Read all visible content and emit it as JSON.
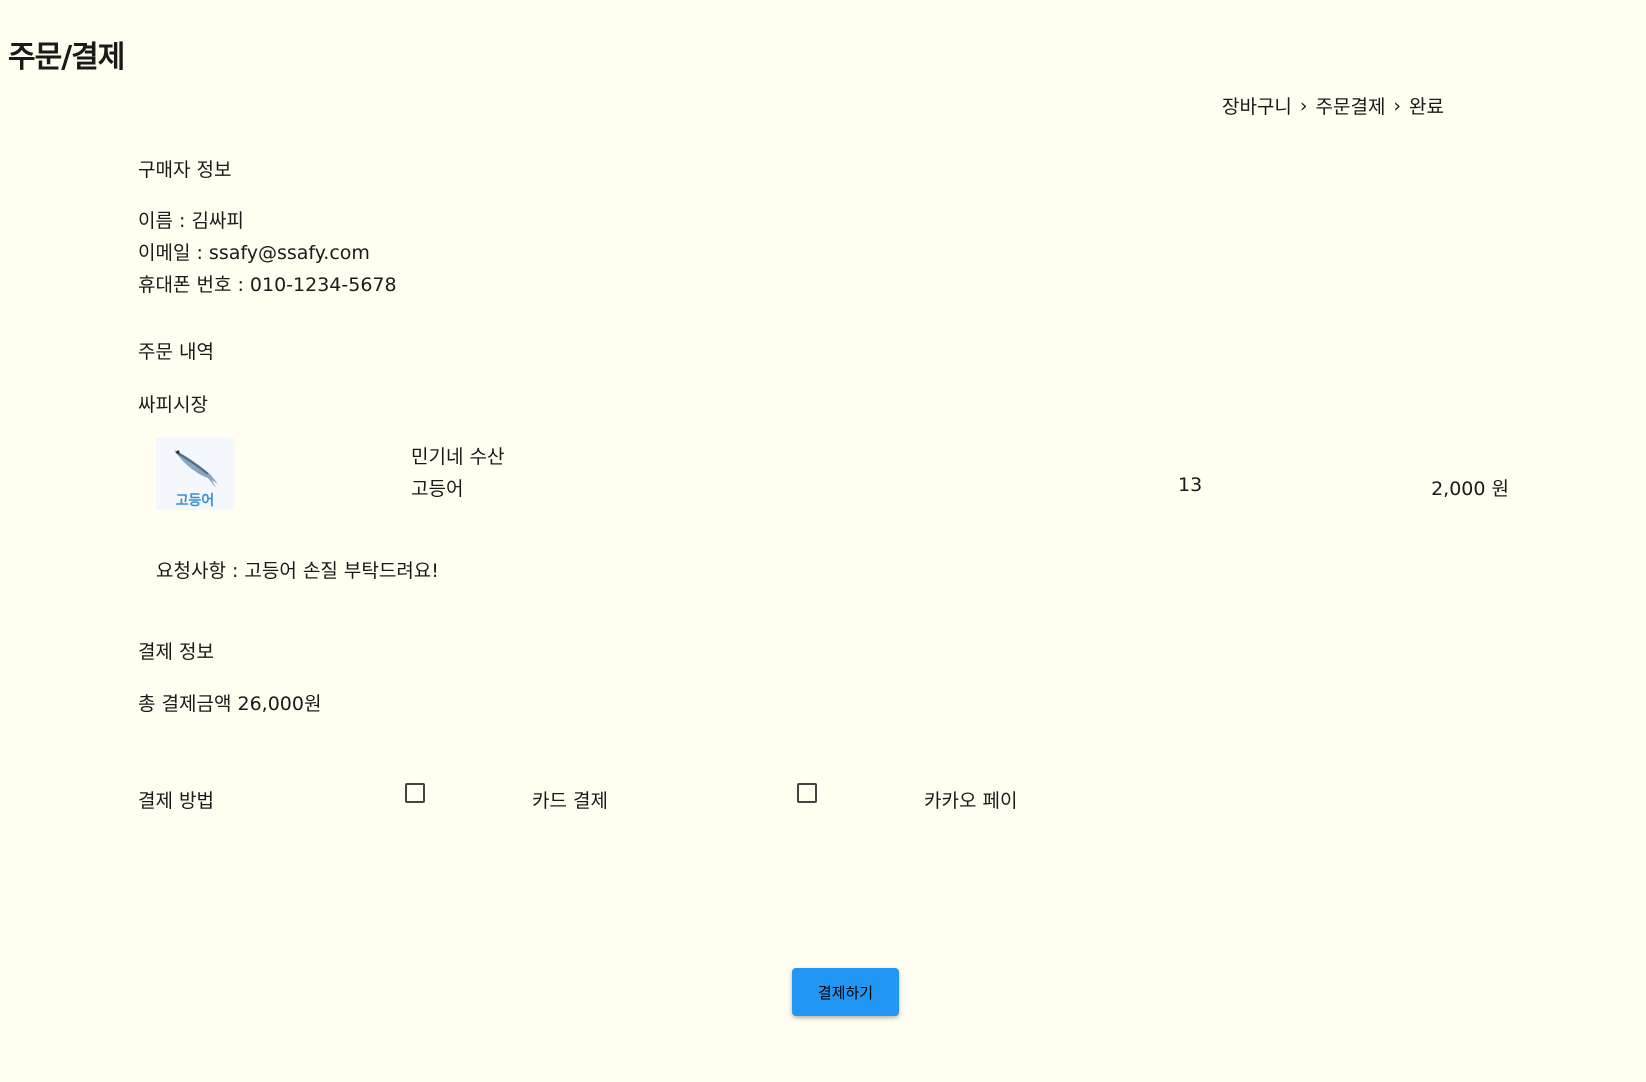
{
  "page": {
    "title": "주문/결제"
  },
  "breadcrumb": {
    "steps": [
      "장바구니",
      "주문결제",
      "완료"
    ],
    "separator": "›"
  },
  "buyer": {
    "section_title": "구매자 정보",
    "name": "이름 : 김싸피",
    "email": "이메일 : ssafy@ssafy.com",
    "phone": "휴대폰 번호 : 010-1234-5678"
  },
  "order": {
    "section_title": "주문 내역",
    "market": "싸피시장",
    "item": {
      "thumbnail_label": "고등어",
      "thumbnail_icon": "fish-icon",
      "store": "민기네 수산",
      "product": "고등어",
      "quantity": "13",
      "price": "2,000 원"
    },
    "request": "요청사항 : 고등어 손질 부탁드려요!"
  },
  "payment": {
    "section_title": "결제 정보",
    "total": "총 결제금액 26,000원",
    "method_label": "결제 방법",
    "methods": [
      {
        "label": "카드 결제",
        "checked": false
      },
      {
        "label": "카카오 페이",
        "checked": false
      }
    ]
  },
  "actions": {
    "submit_label": "결제하기"
  },
  "colors": {
    "background": "#fffef1",
    "button": "#2196f3",
    "thumb_label": "#3f8fd6"
  }
}
